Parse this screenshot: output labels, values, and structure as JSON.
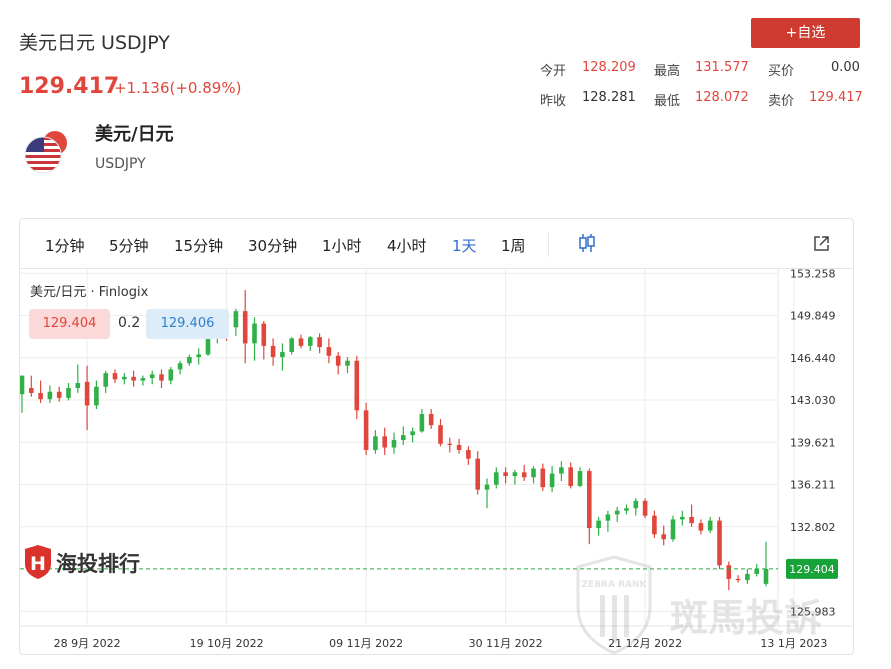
{
  "header": {
    "title": "美元日元 USDJPY",
    "price": "129.417",
    "change": "+1.136(+0.89%)",
    "fav_label": "+自选"
  },
  "stats": {
    "open_label": "今开",
    "open_value": "128.209",
    "high_label": "最高",
    "high_value": "131.577",
    "buy_label": "买价",
    "buy_value": "0.00",
    "prev_label": "昨收",
    "prev_value": "128.281",
    "low_label": "最低",
    "low_value": "128.072",
    "sell_label": "卖价",
    "sell_value": "129.417"
  },
  "pair": {
    "name": "美元/日元",
    "symbol": "USDJPY"
  },
  "toolbar": {
    "timeframes": [
      "1分钟",
      "5分钟",
      "15分钟",
      "30分钟",
      "1小时",
      "4小时",
      "1天",
      "1周"
    ],
    "active_index": 6
  },
  "legend": {
    "name": "美元/日元 · Finlogix",
    "bid": "129.404",
    "spread": "0.2",
    "ask": "129.406"
  },
  "watermark": {
    "brand": "海投排行",
    "zebra_cn": "斑馬投訴",
    "zebra_en": "ZEBRA RANK"
  },
  "colors": {
    "up": "#2fb048",
    "down": "#e0463c",
    "accent": "#2f6fcd",
    "price_tag": "#18a23a"
  },
  "chart_data": {
    "type": "candlestick",
    "price_axis_ticks": [
      125.983,
      129.404,
      132.802,
      136.211,
      139.621,
      143.03,
      146.44,
      149.849,
      153.258
    ],
    "y_range": [
      124.8,
      153.6
    ],
    "current_price_label": "129.404",
    "date_ticks": [
      {
        "label": "28 9月 2022",
        "index": 7
      },
      {
        "label": "19 10月 2022",
        "index": 22
      },
      {
        "label": "09 11月 2022",
        "index": 37
      },
      {
        "label": "30 11月 2022",
        "index": 52
      },
      {
        "label": "21 12月 2022",
        "index": 67
      },
      {
        "label": "13 1月 2023",
        "index": 83
      }
    ],
    "ohlc": [
      [
        143.5,
        145.0,
        142.0,
        145.0
      ],
      [
        144.0,
        145.0,
        143.3,
        143.6
      ],
      [
        143.6,
        144.6,
        142.8,
        143.1
      ],
      [
        143.1,
        144.2,
        142.8,
        143.7
      ],
      [
        143.7,
        144.1,
        142.9,
        143.2
      ],
      [
        143.2,
        144.4,
        143.0,
        144.0
      ],
      [
        144.0,
        145.9,
        143.6,
        144.4
      ],
      [
        144.5,
        145.8,
        140.6,
        142.6
      ],
      [
        142.6,
        144.6,
        142.3,
        144.1
      ],
      [
        144.1,
        145.4,
        143.6,
        145.2
      ],
      [
        145.2,
        145.5,
        144.4,
        144.7
      ],
      [
        144.7,
        145.2,
        144.3,
        144.9
      ],
      [
        144.9,
        145.4,
        144.1,
        144.6
      ],
      [
        144.6,
        145.0,
        144.2,
        144.8
      ],
      [
        144.8,
        145.4,
        144.3,
        145.1
      ],
      [
        145.1,
        145.5,
        144.0,
        144.6
      ],
      [
        144.6,
        145.7,
        144.3,
        145.5
      ],
      [
        145.5,
        146.2,
        145.1,
        146.0
      ],
      [
        146.0,
        146.7,
        145.8,
        146.5
      ],
      [
        146.5,
        147.2,
        145.9,
        146.7
      ],
      [
        146.7,
        148.6,
        146.6,
        148.0
      ],
      [
        148.0,
        148.7,
        147.6,
        148.3
      ],
      [
        148.5,
        148.8,
        147.8,
        148.2
      ],
      [
        148.9,
        150.4,
        148.2,
        150.2
      ],
      [
        150.2,
        151.9,
        146.0,
        147.6
      ],
      [
        147.6,
        149.7,
        146.2,
        149.2
      ],
      [
        149.2,
        149.4,
        146.3,
        147.4
      ],
      [
        147.4,
        148.0,
        145.8,
        146.5
      ],
      [
        146.5,
        147.6,
        145.4,
        146.9
      ],
      [
        146.9,
        148.1,
        146.7,
        148.0
      ],
      [
        148.0,
        148.3,
        147.2,
        147.4
      ],
      [
        147.4,
        148.2,
        147.0,
        148.1
      ],
      [
        148.1,
        148.4,
        146.8,
        147.3
      ],
      [
        147.3,
        148.0,
        146.0,
        146.6
      ],
      [
        146.6,
        146.9,
        145.1,
        145.8
      ],
      [
        145.8,
        146.5,
        145.2,
        146.2
      ],
      [
        146.2,
        146.6,
        141.5,
        142.2
      ],
      [
        142.2,
        142.8,
        138.6,
        139.0
      ],
      [
        139.0,
        140.6,
        138.7,
        140.1
      ],
      [
        140.1,
        140.8,
        138.6,
        139.2
      ],
      [
        139.2,
        140.4,
        138.7,
        139.8
      ],
      [
        139.8,
        140.9,
        139.4,
        140.2
      ],
      [
        140.2,
        140.8,
        139.6,
        140.5
      ],
      [
        140.5,
        142.3,
        140.4,
        141.9
      ],
      [
        141.9,
        142.3,
        140.7,
        141.0
      ],
      [
        141.0,
        141.5,
        139.3,
        139.5
      ],
      [
        139.5,
        140.0,
        138.8,
        139.4
      ],
      [
        139.4,
        139.9,
        138.7,
        139.0
      ],
      [
        139.0,
        139.3,
        137.8,
        138.3
      ],
      [
        138.3,
        138.9,
        135.4,
        135.8
      ],
      [
        135.8,
        136.7,
        134.3,
        136.2
      ],
      [
        136.2,
        137.6,
        135.9,
        137.2
      ],
      [
        137.2,
        137.6,
        136.3,
        136.9
      ],
      [
        136.9,
        137.4,
        136.2,
        137.2
      ],
      [
        137.2,
        137.8,
        136.5,
        136.8
      ],
      [
        136.8,
        137.7,
        136.3,
        137.5
      ],
      [
        137.5,
        137.9,
        135.7,
        136.0
      ],
      [
        136.0,
        137.7,
        135.6,
        137.1
      ],
      [
        137.1,
        138.1,
        136.5,
        137.6
      ],
      [
        137.6,
        138.0,
        135.9,
        136.1
      ],
      [
        136.1,
        137.6,
        136.0,
        137.3
      ],
      [
        137.3,
        137.5,
        131.4,
        132.7
      ],
      [
        132.7,
        133.6,
        132.1,
        133.3
      ],
      [
        133.3,
        134.1,
        132.4,
        133.8
      ],
      [
        133.8,
        134.4,
        133.2,
        134.1
      ],
      [
        134.1,
        134.6,
        133.8,
        134.3
      ],
      [
        134.3,
        135.1,
        133.7,
        134.9
      ],
      [
        134.9,
        135.1,
        133.5,
        133.7
      ],
      [
        133.7,
        134.1,
        131.9,
        132.2
      ],
      [
        132.2,
        132.9,
        131.3,
        131.8
      ],
      [
        131.8,
        133.7,
        131.6,
        133.4
      ],
      [
        133.4,
        134.1,
        132.9,
        133.6
      ],
      [
        133.6,
        134.6,
        132.8,
        133.1
      ],
      [
        133.1,
        133.4,
        132.2,
        132.5
      ],
      [
        132.5,
        133.6,
        132.3,
        133.3
      ],
      [
        133.3,
        133.6,
        129.4,
        129.7
      ],
      [
        129.7,
        130.0,
        127.7,
        128.6
      ],
      [
        128.6,
        128.9,
        128.3,
        128.5
      ],
      [
        128.5,
        129.4,
        128.2,
        129.0
      ],
      [
        129.0,
        129.8,
        128.8,
        129.4
      ],
      [
        128.2,
        131.6,
        128.0,
        129.4
      ]
    ]
  }
}
